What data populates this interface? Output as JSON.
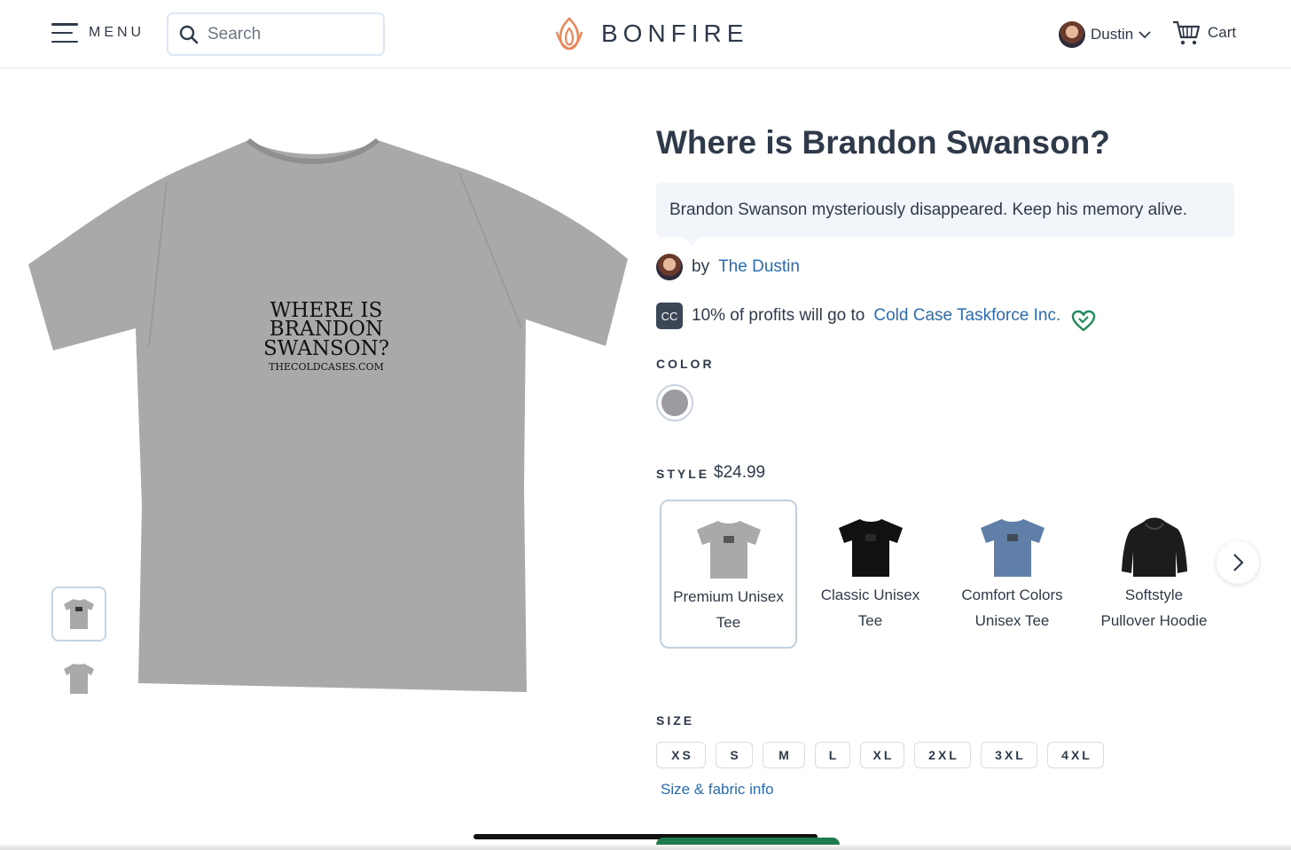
{
  "header": {
    "menu_label": "MENU",
    "search_placeholder": "Search",
    "brand": "BONFIRE",
    "user_name": "Dustin",
    "cart_label": "Cart"
  },
  "product": {
    "title": "Where is Brandon Swanson?",
    "description": "Brandon Swanson mysteriously disappeared. Keep his memory alive.",
    "by_prefix": "by",
    "creator": "The Dustin",
    "charity_badge": "CC",
    "profits_text": "10% of profits will go to",
    "charity_name": "Cold Case Taskforce Inc.",
    "shirt_print": {
      "line1": "WHERE IS",
      "line2": "BRANDON",
      "line3": "SWANSON?",
      "line4": "THECOLDCASES.COM"
    },
    "shirt_color": "#a9a9ab"
  },
  "color": {
    "label": "COLOR",
    "selected": "#9c9ca0"
  },
  "style": {
    "label": "STYLE",
    "price": "$24.99",
    "options": [
      {
        "name": "Premium Unisex Tee",
        "color": "#a9a9ab",
        "kind": "tee",
        "selected": true
      },
      {
        "name": "Classic Unisex Tee",
        "color": "#111111",
        "kind": "tee",
        "selected": false
      },
      {
        "name": "Comfort Colors Unisex Tee",
        "color": "#5f7fa8",
        "kind": "tee",
        "selected": false
      },
      {
        "name": "Softstyle Pullover Hoodie",
        "color": "#1c1c1e",
        "kind": "hoodie",
        "selected": false
      }
    ]
  },
  "size": {
    "label": "SIZE",
    "options": [
      "XS",
      "S",
      "M",
      "L",
      "XL",
      "2XL",
      "3XL",
      "4XL"
    ],
    "info_link": "Size & fabric info"
  },
  "colors": {
    "text": "#2e3a4a",
    "link": "#2b6cb0",
    "logo_flame": "#e8875a",
    "heart": "#1f8a5a",
    "cta": "#1f7a4d"
  }
}
